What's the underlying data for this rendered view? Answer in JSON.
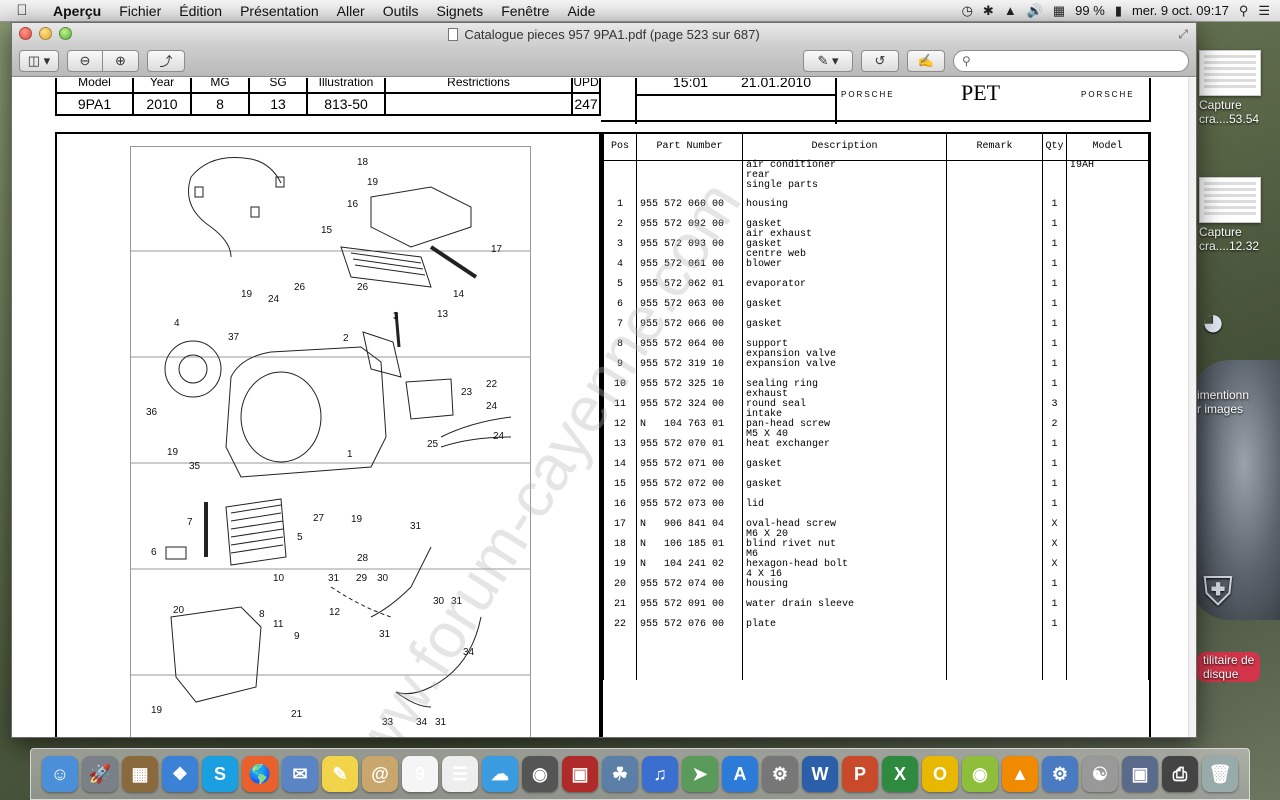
{
  "menubar": {
    "app_name": "Aperçu",
    "items": [
      "Fichier",
      "Édition",
      "Présentation",
      "Aller",
      "Outils",
      "Signets",
      "Fenêtre",
      "Aide"
    ],
    "battery": "99 %",
    "clock": "mer. 9 oct.  09:17"
  },
  "desktop": {
    "icons": [
      {
        "label": "Capture\ncra....53.54"
      },
      {
        "label": "Capture\ncra....12.32"
      },
      {
        "label": "imentionn\nr images"
      },
      {
        "label": "tilitaire de\ndisque"
      }
    ]
  },
  "window": {
    "title": "Catalogue pieces 957 9PA1.pdf (page 523 sur 687)"
  },
  "toolbar": {
    "search_placeholder": ""
  },
  "doc": {
    "header": {
      "labels": [
        "Model",
        "Year",
        "MG",
        "SG",
        "Illustration",
        "Restrictions",
        "UPD"
      ],
      "values": [
        "9PA1",
        "2010",
        "8",
        "13",
        "813-50",
        "",
        "247"
      ],
      "time": "15:01",
      "date": "21.01.2010",
      "brand": "PORSCHE",
      "pet": "PET"
    },
    "watermark": "www.forum-cayenne.com",
    "parts_table": {
      "headers": [
        "Pos",
        "Part Number",
        "Description",
        "Remark",
        "Qty",
        "Model"
      ],
      "rows": [
        {
          "pos": "",
          "pn": "",
          "desc": "air conditioner\nrear\nsingle parts",
          "remark": "",
          "qty": "",
          "model": "I9AH"
        },
        {
          "pos": "1",
          "pn": "955 572 060 00",
          "desc": "housing",
          "remark": "",
          "qty": "1",
          "model": ""
        },
        {
          "pos": "2",
          "pn": "955 572 092 00",
          "desc": "gasket\nair exhaust",
          "remark": "",
          "qty": "1",
          "model": ""
        },
        {
          "pos": "3",
          "pn": "955 572 093 00",
          "desc": "gasket\ncentre web",
          "remark": "",
          "qty": "1",
          "model": ""
        },
        {
          "pos": "4",
          "pn": "955 572 061 00",
          "desc": "blower",
          "remark": "",
          "qty": "1",
          "model": ""
        },
        {
          "pos": "5",
          "pn": "955 572 062 01",
          "desc": "evaporator",
          "remark": "",
          "qty": "1",
          "model": ""
        },
        {
          "pos": "6",
          "pn": "955 572 063 00",
          "desc": "gasket",
          "remark": "",
          "qty": "1",
          "model": ""
        },
        {
          "pos": "7",
          "pn": "955 572 066 00",
          "desc": "gasket",
          "remark": "",
          "qty": "1",
          "model": ""
        },
        {
          "pos": "8",
          "pn": "955 572 064 00",
          "desc": "support\nexpansion valve",
          "remark": "",
          "qty": "1",
          "model": ""
        },
        {
          "pos": "9",
          "pn": "955 572 319 10",
          "desc": "expansion valve",
          "remark": "",
          "qty": "1",
          "model": ""
        },
        {
          "pos": "10",
          "pn": "955 572 325 10",
          "desc": "sealing ring\nexhaust",
          "remark": "",
          "qty": "1",
          "model": ""
        },
        {
          "pos": "11",
          "pn": "955 572 324 00",
          "desc": "round seal\nintake",
          "remark": "",
          "qty": "3",
          "model": ""
        },
        {
          "pos": "12",
          "pn": "N   104 763 01",
          "desc": "pan-head screw\nM5 X 40",
          "remark": "",
          "qty": "2",
          "model": ""
        },
        {
          "pos": "13",
          "pn": "955 572 070 01",
          "desc": "heat exchanger",
          "remark": "",
          "qty": "1",
          "model": ""
        },
        {
          "pos": "14",
          "pn": "955 572 071 00",
          "desc": "gasket",
          "remark": "",
          "qty": "1",
          "model": ""
        },
        {
          "pos": "15",
          "pn": "955 572 072 00",
          "desc": "gasket",
          "remark": "",
          "qty": "1",
          "model": ""
        },
        {
          "pos": "16",
          "pn": "955 572 073 00",
          "desc": "lid",
          "remark": "",
          "qty": "1",
          "model": ""
        },
        {
          "pos": "17",
          "pn": "N   906 841 04",
          "desc": "oval-head screw\nM6 X 20",
          "remark": "",
          "qty": "X",
          "model": ""
        },
        {
          "pos": "18",
          "pn": "N   106 185 01",
          "desc": "blind rivet nut\nM6",
          "remark": "",
          "qty": "X",
          "model": ""
        },
        {
          "pos": "19",
          "pn": "N   104 241 02",
          "desc": "hexagon-head bolt\n4 X 16",
          "remark": "",
          "qty": "X",
          "model": ""
        },
        {
          "pos": "20",
          "pn": "955 572 074 00",
          "desc": "housing",
          "remark": "",
          "qty": "1",
          "model": ""
        },
        {
          "pos": "21",
          "pn": "955 572 091 00",
          "desc": "water drain sleeve",
          "remark": "",
          "qty": "1",
          "model": ""
        },
        {
          "pos": "22",
          "pn": "955 572 076 00",
          "desc": "plate",
          "remark": "",
          "qty": "1",
          "model": ""
        }
      ]
    },
    "illustration_labels": [
      "18",
      "19",
      "16",
      "17",
      "15",
      "13",
      "14",
      "26",
      "26",
      "24",
      "19",
      "37",
      "4",
      "2",
      "3",
      "22",
      "23",
      "24",
      "24",
      "36",
      "19",
      "35",
      "25",
      "1",
      "27",
      "19",
      "7",
      "5",
      "6",
      "31",
      "28",
      "31",
      "29",
      "30",
      "10",
      "8",
      "11",
      "9",
      "12",
      "30",
      "31",
      "20",
      "34",
      "31",
      "19",
      "21",
      "33",
      "34",
      "31"
    ]
  },
  "dock": {
    "icons": [
      "finder-icon",
      "launchpad-icon",
      "app-store-mosaic-icon",
      "safari-icon",
      "skype-icon",
      "firefox-icon",
      "mail-icon",
      "notes-icon",
      "contacts-icon",
      "calendar-icon",
      "reminders-icon",
      "messages-icon",
      "facetime-icon",
      "photo-booth-icon",
      "iphoto-icon",
      "itunes-icon",
      "migration-icon",
      "app-store-icon",
      "system-prefs-icon",
      "word-icon",
      "powerpoint-icon",
      "excel-icon",
      "outlook-icon",
      "tennis-icon",
      "vlc-icon",
      "network-icon",
      "directory-icon",
      "preview-icon",
      "scanner-icon",
      "trash-icon"
    ]
  }
}
